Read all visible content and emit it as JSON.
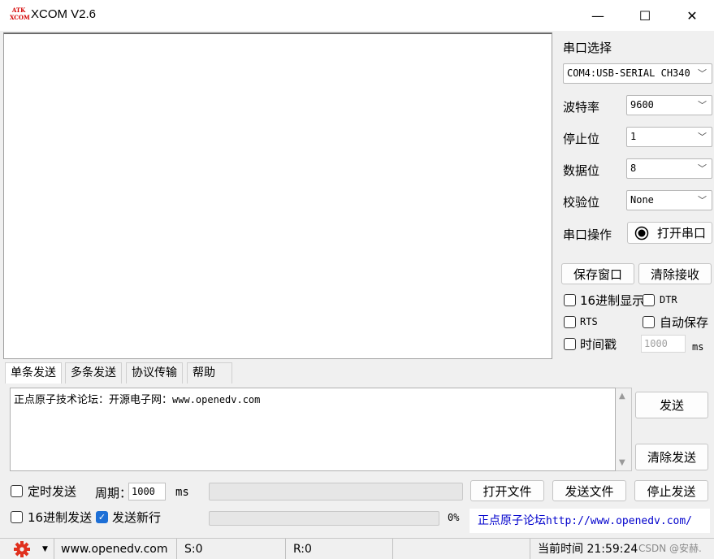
{
  "titlebar": {
    "logo_text": "ATK XCOM",
    "title": "XCOM V2.6",
    "minimize_glyph": "—",
    "maximize_glyph": "☐",
    "close_glyph": "✕"
  },
  "settings": {
    "port_select_label": "串口选择",
    "port_value": "COM4:USB-SERIAL CH340",
    "baud_label": "波特率",
    "baud_value": "9600",
    "stopbits_label": "停止位",
    "stopbits_value": "1",
    "databits_label": "数据位",
    "databits_value": "8",
    "parity_label": "校验位",
    "parity_value": "None",
    "operation_label": "串口操作",
    "open_port_button": "打开串口"
  },
  "receive_controls": {
    "save_window_button": "保存窗口",
    "clear_receive_button": "清除接收",
    "hex_display_label": "16进制显示",
    "dtr_label": "DTR",
    "rts_label": "RTS",
    "auto_save_label": "自动保存",
    "timestamp_label": "时间戳",
    "timestamp_value": "1000",
    "timestamp_unit": "ms"
  },
  "tabs": [
    "单条发送",
    "多条发送",
    "协议传输",
    "帮助"
  ],
  "send": {
    "text_cn": "正点原子技术论坛：开源电子网：",
    "text_url": "www.openedv.com",
    "send_button": "发送",
    "clear_send_button": "清除发送"
  },
  "bottom": {
    "timed_send_label": "定时发送",
    "period_label": "周期：",
    "period_value": "1000",
    "period_unit": "ms",
    "hex_send_label": "16进制发送",
    "send_newline_label": "发送新行",
    "send_newline_checked": true,
    "progress_percent": "0%",
    "progress_fraction": 0,
    "open_file_button": "打开文件",
    "send_file_button": "发送文件",
    "stop_send_button": "停止发送",
    "forum_link_cn": "正点原子论坛",
    "forum_link_url": "http://www.openedv.com/"
  },
  "statusbar": {
    "website": "www.openedv.com",
    "sent": "S:0",
    "received": "R:0",
    "current_time_label": "当前时间",
    "current_time": "21:59:24",
    "watermark": "CSDN @安赫."
  },
  "colors": {
    "accent": "#1d6fd6",
    "link": "#0000cc",
    "gear": "#e0301e"
  }
}
